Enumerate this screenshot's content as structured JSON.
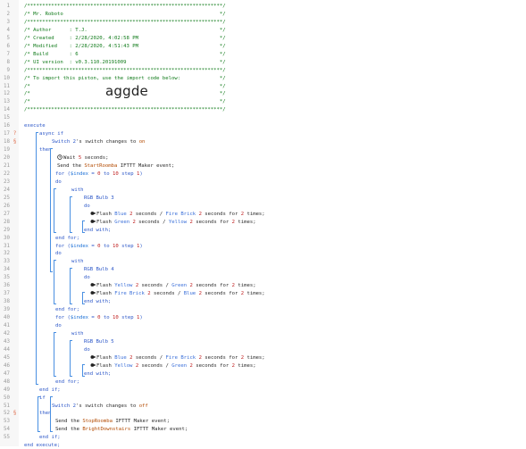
{
  "header": {
    "lines": [
      "/*****************************************************************/",
      "/* Mr. Roboto                                                    */",
      "/*****************************************************************/",
      "/* Author      : T.J.                                            */",
      "/* Created     : 2/28/2020, 4:02:58 PM                           */",
      "/* Modified    : 2/28/2020, 4:51:43 PM                           */",
      "/* Build       : 6                                               */",
      "/* UI version  : v0.3.110.20191009                               */",
      "/*****************************************************************/",
      "/* To import this piston, use the import code below:             */",
      "/*                                                               */",
      "/*                                                               */",
      "/*                                                               */",
      "/*****************************************************************/"
    ],
    "import_code": "aggde"
  },
  "code": [
    [
      {
        "t": "",
        "c": "plain"
      }
    ],
    [
      {
        "t": "execute",
        "c": "keyword"
      }
    ],
    [
      {
        "t": "async if",
        "c": "keyword"
      }
    ],
    [
      {
        "t": "Switch 2",
        "c": "device"
      },
      {
        "t": "'s switch changes to ",
        "c": "plain"
      },
      {
        "t": "on",
        "c": "value"
      }
    ],
    [
      {
        "t": "then",
        "c": "keyword"
      }
    ],
    [
      {
        "t": "Wait ",
        "c": "plain"
      },
      {
        "t": "5",
        "c": "number"
      },
      {
        "t": " seconds;",
        "c": "plain"
      }
    ],
    [
      {
        "t": "Send the ",
        "c": "plain"
      },
      {
        "t": "StartRoomba",
        "c": "ifttt"
      },
      {
        "t": " IFTTT Maker event;",
        "c": "plain"
      }
    ],
    [
      {
        "t": "for (",
        "c": "keyword"
      },
      {
        "t": "$index",
        "c": "var"
      },
      {
        "t": " = ",
        "c": "keyword"
      },
      {
        "t": "0",
        "c": "number"
      },
      {
        "t": " to ",
        "c": "keyword"
      },
      {
        "t": "10",
        "c": "number"
      },
      {
        "t": " step ",
        "c": "keyword"
      },
      {
        "t": "1",
        "c": "number"
      },
      {
        "t": ")",
        "c": "keyword"
      }
    ],
    [
      {
        "t": "do",
        "c": "keyword"
      }
    ],
    [
      {
        "t": "with",
        "c": "keyword"
      }
    ],
    [
      {
        "t": "RGB Bulb 3",
        "c": "device"
      }
    ],
    [
      {
        "t": "do",
        "c": "keyword"
      }
    ],
    [
      {
        "t": "Flash ",
        "c": "plain"
      },
      {
        "t": "Blue",
        "c": "color"
      },
      {
        "t": " ",
        "c": "plain"
      },
      {
        "t": "2",
        "c": "number"
      },
      {
        "t": " seconds / ",
        "c": "plain"
      },
      {
        "t": "Fire Brick",
        "c": "color"
      },
      {
        "t": " ",
        "c": "plain"
      },
      {
        "t": "2",
        "c": "number"
      },
      {
        "t": " seconds for ",
        "c": "plain"
      },
      {
        "t": "2",
        "c": "number"
      },
      {
        "t": " times;",
        "c": "plain"
      }
    ],
    [
      {
        "t": "Flash ",
        "c": "plain"
      },
      {
        "t": "Green",
        "c": "color"
      },
      {
        "t": " ",
        "c": "plain"
      },
      {
        "t": "2",
        "c": "number"
      },
      {
        "t": " seconds / ",
        "c": "plain"
      },
      {
        "t": "Yellow",
        "c": "color"
      },
      {
        "t": " ",
        "c": "plain"
      },
      {
        "t": "2",
        "c": "number"
      },
      {
        "t": " seconds for ",
        "c": "plain"
      },
      {
        "t": "2",
        "c": "number"
      },
      {
        "t": " times;",
        "c": "plain"
      }
    ],
    [
      {
        "t": "end with;",
        "c": "keyword"
      }
    ],
    [
      {
        "t": "end for;",
        "c": "keyword"
      }
    ],
    [
      {
        "t": "for (",
        "c": "keyword"
      },
      {
        "t": "$index",
        "c": "var"
      },
      {
        "t": " = ",
        "c": "keyword"
      },
      {
        "t": "0",
        "c": "number"
      },
      {
        "t": " to ",
        "c": "keyword"
      },
      {
        "t": "10",
        "c": "number"
      },
      {
        "t": " step ",
        "c": "keyword"
      },
      {
        "t": "1",
        "c": "number"
      },
      {
        "t": ")",
        "c": "keyword"
      }
    ],
    [
      {
        "t": "do",
        "c": "keyword"
      }
    ],
    [
      {
        "t": "with",
        "c": "keyword"
      }
    ],
    [
      {
        "t": "RGB Bulb 4",
        "c": "device"
      }
    ],
    [
      {
        "t": "do",
        "c": "keyword"
      }
    ],
    [
      {
        "t": "Flash ",
        "c": "plain"
      },
      {
        "t": "Yellow",
        "c": "color"
      },
      {
        "t": " ",
        "c": "plain"
      },
      {
        "t": "2",
        "c": "number"
      },
      {
        "t": " seconds / ",
        "c": "plain"
      },
      {
        "t": "Green",
        "c": "color"
      },
      {
        "t": " ",
        "c": "plain"
      },
      {
        "t": "2",
        "c": "number"
      },
      {
        "t": " seconds for ",
        "c": "plain"
      },
      {
        "t": "2",
        "c": "number"
      },
      {
        "t": " times;",
        "c": "plain"
      }
    ],
    [
      {
        "t": "Flash ",
        "c": "plain"
      },
      {
        "t": "Fire Brick",
        "c": "color"
      },
      {
        "t": " ",
        "c": "plain"
      },
      {
        "t": "2",
        "c": "number"
      },
      {
        "t": " seconds / ",
        "c": "plain"
      },
      {
        "t": "Blue",
        "c": "color"
      },
      {
        "t": " ",
        "c": "plain"
      },
      {
        "t": "2",
        "c": "number"
      },
      {
        "t": " seconds for ",
        "c": "plain"
      },
      {
        "t": "2",
        "c": "number"
      },
      {
        "t": " times;",
        "c": "plain"
      }
    ],
    [
      {
        "t": "end with;",
        "c": "keyword"
      }
    ],
    [
      {
        "t": "end for;",
        "c": "keyword"
      }
    ],
    [
      {
        "t": "for (",
        "c": "keyword"
      },
      {
        "t": "$index",
        "c": "var"
      },
      {
        "t": " = ",
        "c": "keyword"
      },
      {
        "t": "0",
        "c": "number"
      },
      {
        "t": " to ",
        "c": "keyword"
      },
      {
        "t": "10",
        "c": "number"
      },
      {
        "t": " step ",
        "c": "keyword"
      },
      {
        "t": "1",
        "c": "number"
      },
      {
        "t": ")",
        "c": "keyword"
      }
    ],
    [
      {
        "t": "do",
        "c": "keyword"
      }
    ],
    [
      {
        "t": "with",
        "c": "keyword"
      }
    ],
    [
      {
        "t": "RGB Bulb 5",
        "c": "device"
      }
    ],
    [
      {
        "t": "do",
        "c": "keyword"
      }
    ],
    [
      {
        "t": "Flash ",
        "c": "plain"
      },
      {
        "t": "Blue",
        "c": "color"
      },
      {
        "t": " ",
        "c": "plain"
      },
      {
        "t": "2",
        "c": "number"
      },
      {
        "t": " seconds / ",
        "c": "plain"
      },
      {
        "t": "Fire Brick",
        "c": "color"
      },
      {
        "t": " ",
        "c": "plain"
      },
      {
        "t": "2",
        "c": "number"
      },
      {
        "t": " seconds for ",
        "c": "plain"
      },
      {
        "t": "2",
        "c": "number"
      },
      {
        "t": " times;",
        "c": "plain"
      }
    ],
    [
      {
        "t": "Flash ",
        "c": "plain"
      },
      {
        "t": "Yellow",
        "c": "color"
      },
      {
        "t": " ",
        "c": "plain"
      },
      {
        "t": "2",
        "c": "number"
      },
      {
        "t": " seconds / ",
        "c": "plain"
      },
      {
        "t": "Green",
        "c": "color"
      },
      {
        "t": " ",
        "c": "plain"
      },
      {
        "t": "2",
        "c": "number"
      },
      {
        "t": " seconds for ",
        "c": "plain"
      },
      {
        "t": "2",
        "c": "number"
      },
      {
        "t": " times;",
        "c": "plain"
      }
    ],
    [
      {
        "t": "end with;",
        "c": "keyword"
      }
    ],
    [
      {
        "t": "end for;",
        "c": "keyword"
      }
    ],
    [
      {
        "t": "end if;",
        "c": "keyword"
      }
    ],
    [
      {
        "t": "if",
        "c": "keyword"
      }
    ],
    [
      {
        "t": "Switch 2",
        "c": "device"
      },
      {
        "t": "'s switch changes to ",
        "c": "plain"
      },
      {
        "t": "off",
        "c": "value"
      }
    ],
    [
      {
        "t": "then",
        "c": "keyword"
      }
    ],
    [
      {
        "t": "Send the ",
        "c": "plain"
      },
      {
        "t": "StopRoomba",
        "c": "ifttt"
      },
      {
        "t": " IFTTT Maker event;",
        "c": "plain"
      }
    ],
    [
      {
        "t": "Send the ",
        "c": "plain"
      },
      {
        "t": "BrightDownstairs",
        "c": "ifttt"
      },
      {
        "t": " IFTTT Maker event;",
        "c": "plain"
      }
    ],
    [
      {
        "t": "end if;",
        "c": "keyword"
      }
    ],
    [
      {
        "t": "end execute;",
        "c": "keyword"
      }
    ]
  ],
  "line_numbers": [
    "1",
    "2",
    "3",
    "4",
    "5",
    "6",
    "7",
    "8",
    "9",
    "10",
    "11",
    "12",
    "13",
    "14",
    "15",
    "16",
    "17",
    "18",
    "19",
    "20",
    "21",
    "22",
    "23",
    "24",
    "25",
    "26",
    "27",
    "28",
    "29",
    "30",
    "31",
    "32",
    "33",
    "34",
    "35",
    "36",
    "37",
    "38",
    "39",
    "40",
    "41",
    "42",
    "43",
    "44",
    "45",
    "46",
    "47",
    "48",
    "49",
    "50",
    "51",
    "52",
    "53",
    "54",
    "55"
  ],
  "icons": {
    "clock": "clock-icon",
    "flash": "bulb-icon",
    "fold_marker": "fold-marker-icon"
  }
}
